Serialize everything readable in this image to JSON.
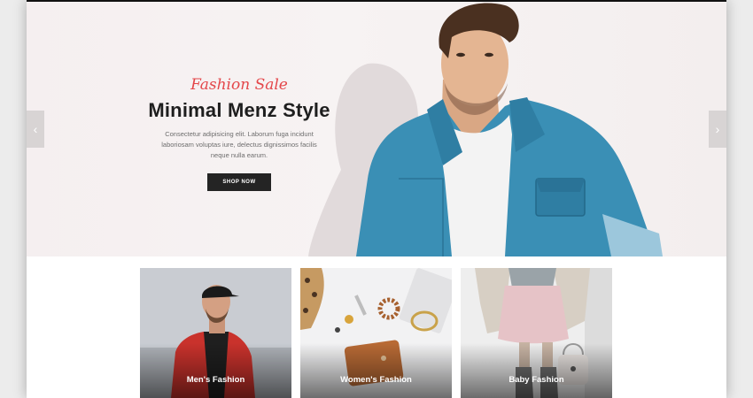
{
  "hero": {
    "kicker": "Fashion Sale",
    "title": "Minimal Menz Style",
    "description": "Consectetur adipisicing elit. Laborum fuga incidunt laboriosam voluptas iure, delectus dignissimos facilis neque nulla earum.",
    "button_label": "SHOP NOW",
    "prev_arrow_icon": "chevron-left-icon",
    "next_arrow_icon": "chevron-right-icon",
    "accent_color": "#e4474a"
  },
  "categories": [
    {
      "label": "Men's Fashion"
    },
    {
      "label": "Women's Fashion"
    },
    {
      "label": "Baby Fashion"
    }
  ]
}
